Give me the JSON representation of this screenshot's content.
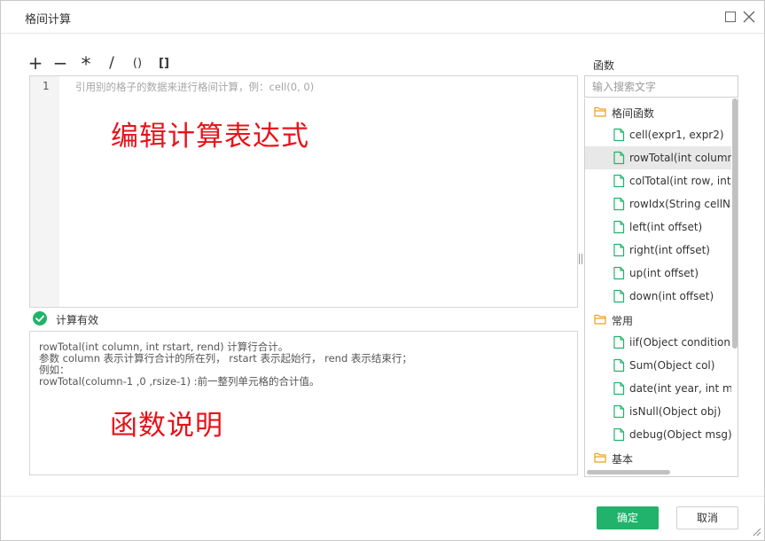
{
  "window": {
    "title": "格间计算"
  },
  "toolbar": {
    "operators": [
      "+",
      "−",
      "*",
      "/",
      "()",
      "[]"
    ]
  },
  "editor": {
    "line_number": "1",
    "placeholder": "引用别的格子的数据来进行格间计算，例：cell(0, 0)",
    "overlay_label": "编辑计算表达式"
  },
  "status": {
    "text": "计算有效"
  },
  "description": {
    "lines": [
      "rowTotal(int column, int rstart, rend) 计算行合计。",
      "参数 column 表示计算行合计的所在列，  rstart 表示起始行，  rend 表示结束行；",
      "例如：",
      "rowTotal(column-1 ,0 ,rsize-1) :前一整列单元格的合计值。"
    ],
    "overlay_label": "函数说明"
  },
  "function_panel": {
    "title": "函数",
    "search_placeholder": "输入搜索文字",
    "tree": [
      {
        "type": "folder",
        "label": "格间函数"
      },
      {
        "type": "file",
        "label": "cell(expr1, expr2)"
      },
      {
        "type": "file",
        "label": "rowTotal(int column, int rstart, rend)",
        "selected": true
      },
      {
        "type": "file",
        "label": "colTotal(int row, int cstart, cend)"
      },
      {
        "type": "file",
        "label": "rowIdx(String cellName)"
      },
      {
        "type": "file",
        "label": "left(int offset)"
      },
      {
        "type": "file",
        "label": "right(int offset)"
      },
      {
        "type": "file",
        "label": "up(int offset)"
      },
      {
        "type": "file",
        "label": "down(int offset)"
      },
      {
        "type": "folder",
        "label": "常用"
      },
      {
        "type": "file",
        "label": "iif(Object condition, Object a, Object b)"
      },
      {
        "type": "file",
        "label": "Sum(Object col)"
      },
      {
        "type": "file",
        "label": "date(int year, int month, int day)"
      },
      {
        "type": "file",
        "label": "isNull(Object obj)"
      },
      {
        "type": "file",
        "label": "debug(Object msg)"
      },
      {
        "type": "folder",
        "label": "基本"
      }
    ]
  },
  "buttons": {
    "ok": "确定",
    "cancel": "取消"
  },
  "colors": {
    "accent": "#21b36b",
    "folder": "#f0a020",
    "file": "#21b36b",
    "overlay": "#e8121a"
  }
}
